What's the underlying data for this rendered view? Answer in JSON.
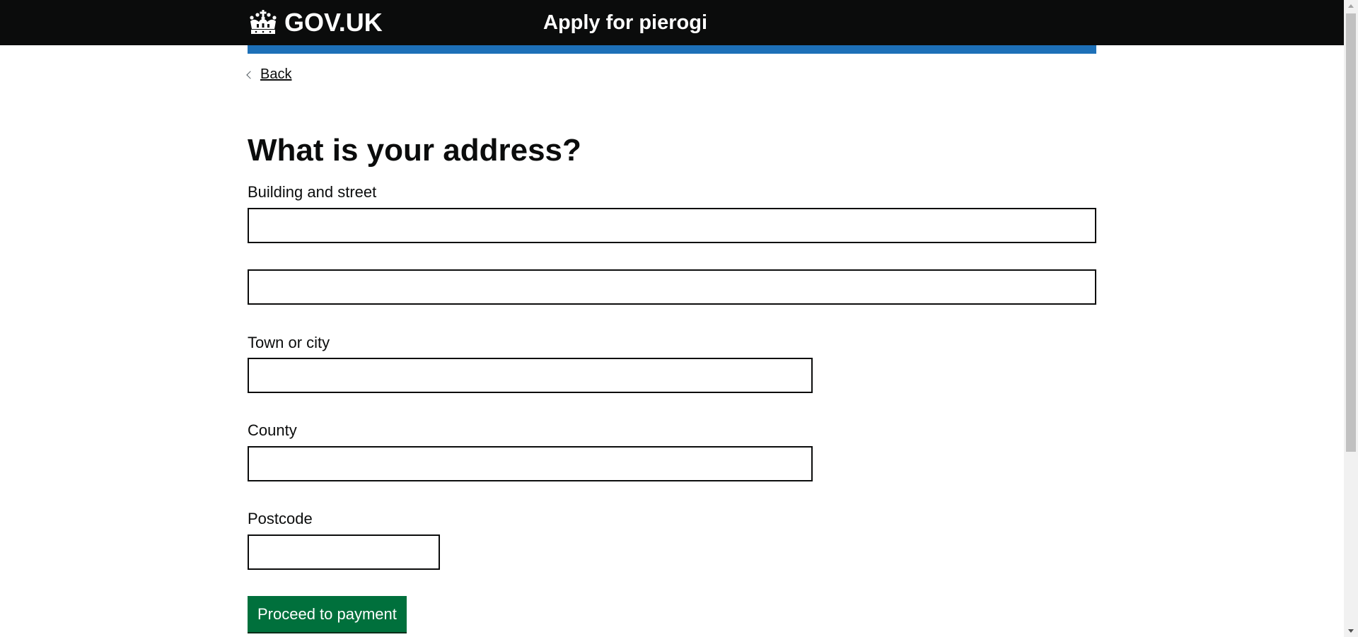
{
  "header": {
    "logo_text": "GOV.UK",
    "logo_icon": "crown-icon",
    "service_name": "Apply for pierogi",
    "background_color": "#0b0c0c",
    "accent_bar_color": "#1d70b8"
  },
  "nav": {
    "back_label": "Back",
    "back_icon": "chevron-left-icon"
  },
  "main": {
    "title": "What is your address?",
    "fields": {
      "building_label": "Building and street",
      "building_line1_value": "",
      "building_line2_value": "",
      "town_label": "Town or city",
      "town_value": "",
      "county_label": "County",
      "county_value": "",
      "postcode_label": "Postcode",
      "postcode_value": ""
    },
    "submit_label": "Proceed to payment",
    "submit_color": "#00703c"
  }
}
